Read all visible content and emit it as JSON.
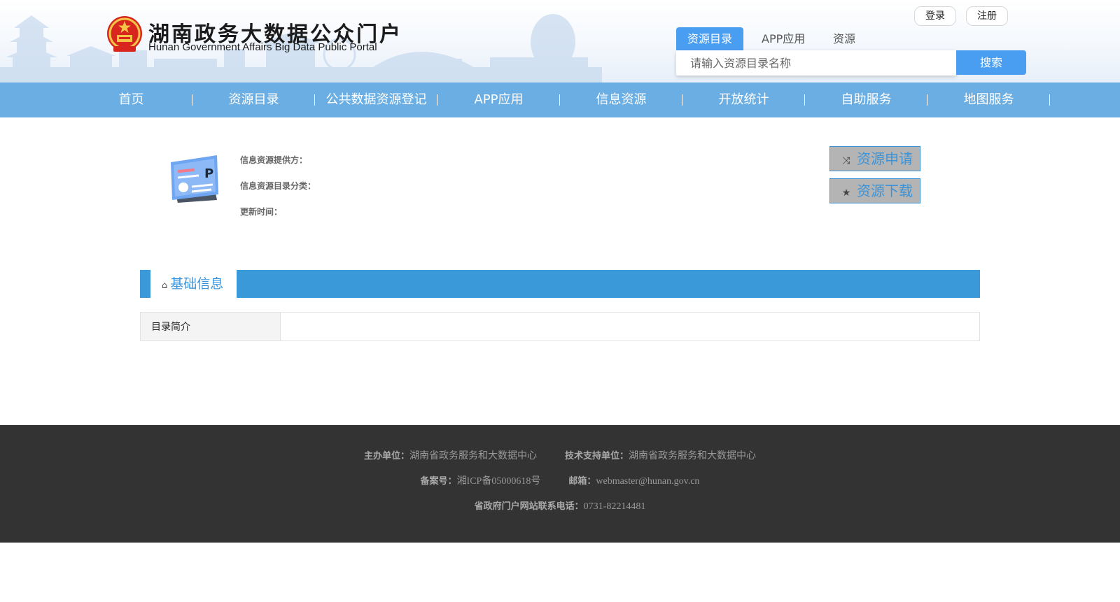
{
  "header": {
    "title": "湖南政务大数据公众门户",
    "subtitle": "Hunan Government Affairs Big Data Public Portal",
    "login_label": "登录",
    "register_label": "注册"
  },
  "search": {
    "tabs": [
      {
        "label": "资源目录",
        "active": true
      },
      {
        "label": "APP应用",
        "active": false
      },
      {
        "label": "资源",
        "active": false
      }
    ],
    "placeholder": "请输入资源目录名称",
    "button_label": "搜索"
  },
  "nav": {
    "items": [
      {
        "label": "首页"
      },
      {
        "label": "资源目录"
      },
      {
        "label": "公共数据资源登记"
      },
      {
        "label": "APP应用"
      },
      {
        "label": "信息资源"
      },
      {
        "label": "开放统计"
      },
      {
        "label": "自助服务"
      },
      {
        "label": "地图服务"
      }
    ]
  },
  "resource": {
    "provider_label": "信息资源提供方：",
    "category_label": "信息资源目录分类：",
    "updated_label": "更新时间：",
    "apply_label": "资源申请",
    "download_label": "资源下载"
  },
  "tabs": {
    "basic_info_label": "基础信息"
  },
  "info_table": {
    "rows": [
      {
        "label": "目录简介",
        "value": ""
      }
    ]
  },
  "footer": {
    "host_label": "主办单位：",
    "host_value": "湖南省政务服务和大数据中心",
    "tech_label": "技术支持单位：",
    "tech_value": "湖南省政务服务和大数据中心",
    "icp_label": "备案号：",
    "icp_value": "湘ICP备05000618号",
    "email_label": "邮箱：",
    "email_value": "webmaster@hunan.gov.cn",
    "phone_label": "省政府门户网站联系电话：",
    "phone_value": "0731-82214481"
  },
  "colors": {
    "primary": "#4a9ef2",
    "nav_bg": "#6aaee3",
    "tabbar_bg": "#3a9ad9",
    "footer_bg": "#333333"
  },
  "icons": [
    "national-emblem",
    "shuffle-icon",
    "star-icon",
    "home-icon",
    "resource-document-icon"
  ]
}
